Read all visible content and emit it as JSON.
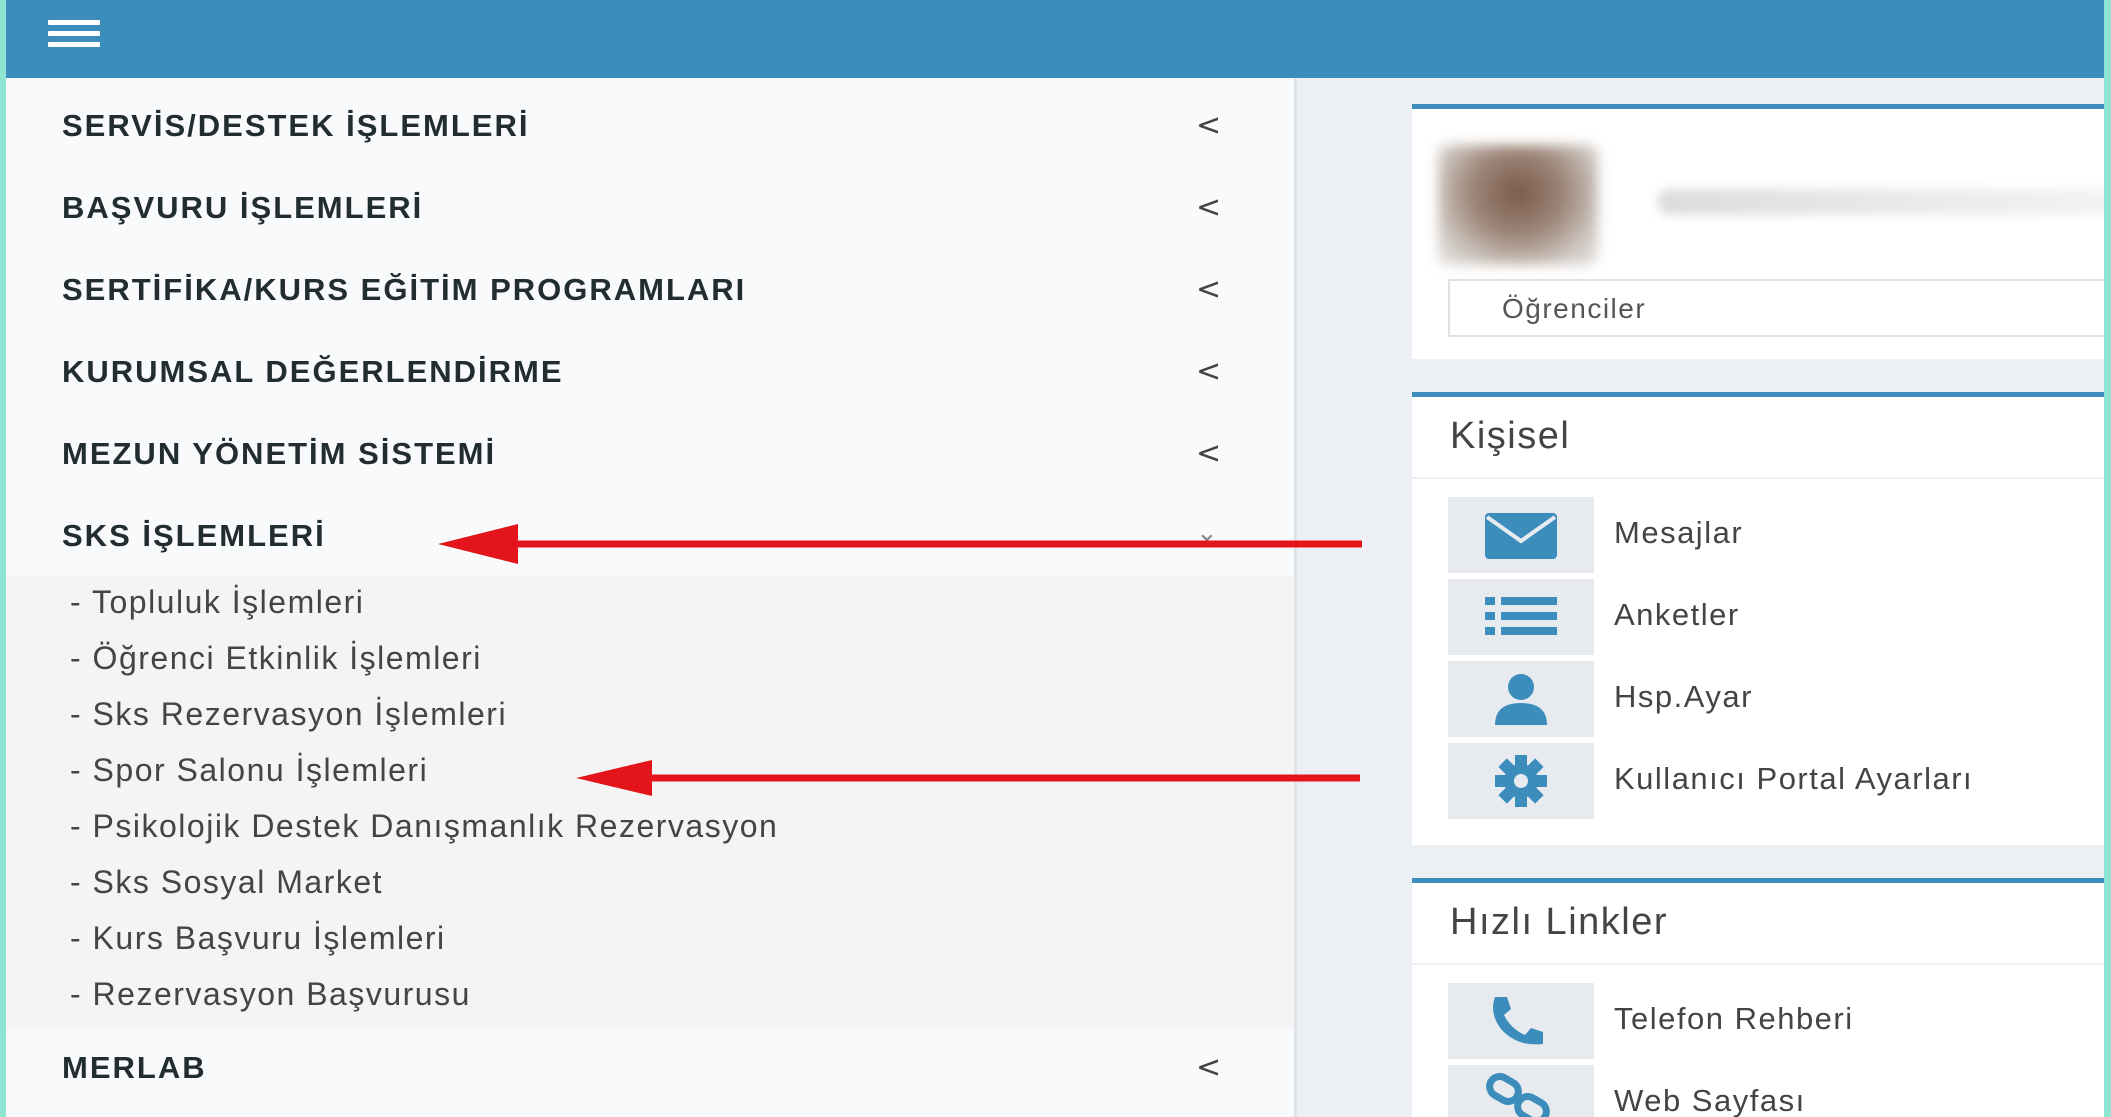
{
  "sidebar": {
    "items": [
      {
        "label": "SERVİS/DESTEK İŞLEMLERİ",
        "chevron": "<"
      },
      {
        "label": "BAŞVURU İŞLEMLERİ",
        "chevron": "<"
      },
      {
        "label": "SERTİFİKA/KURS EĞİTİM PROGRAMLARI",
        "chevron": "<"
      },
      {
        "label": "KURUMSAL DEĞERLENDİRME",
        "chevron": "<"
      },
      {
        "label": "MEZUN YÖNETİM SİSTEMİ",
        "chevron": "<"
      },
      {
        "label": "SKS İŞLEMLERİ",
        "chevron": "⌄"
      }
    ],
    "subitems": [
      "- Topluluk İşlemleri",
      "- Öğrenci Etkinlik İşlemleri",
      "- Sks Rezervasyon İşlemleri",
      "- Spor Salonu İşlemleri",
      "- Psikolojik Destek Danışmanlık Rezervasyon",
      "- Sks Sosyal Market",
      "- Kurs Başvuru İşlemleri",
      "- Rezervasyon Başvurusu"
    ],
    "last_item": {
      "label": "MERLAB",
      "chevron": "<"
    }
  },
  "profile": {
    "role": "Öğrenciler"
  },
  "personal": {
    "title": "Kişisel",
    "items": [
      {
        "label": "Mesajlar",
        "icon": "envelope-icon"
      },
      {
        "label": "Anketler",
        "icon": "list-icon"
      },
      {
        "label": "Hsp.Ayar",
        "icon": "user-icon"
      },
      {
        "label": "Kullanıcı Portal Ayarları",
        "icon": "gear-icon"
      }
    ]
  },
  "quick_links": {
    "title": "Hızlı Linkler",
    "items": [
      {
        "label": "Telefon Rehberi",
        "icon": "phone-icon"
      },
      {
        "label": "Web Sayfası",
        "icon": "link-icon"
      }
    ]
  },
  "colors": {
    "header": "#3c8dbc",
    "arrow": "#e3151a",
    "icon": "#3c8dbc"
  }
}
